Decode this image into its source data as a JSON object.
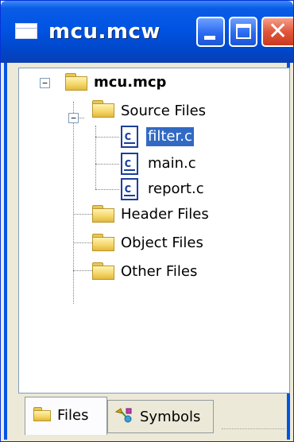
{
  "window": {
    "title": "mcu.mcw",
    "accent": "#0054e3",
    "selection_color": "#316ac5"
  },
  "tree": {
    "root": {
      "label": "mcu.mcp",
      "icon": "folder-icon",
      "expanded": true
    },
    "source_files": {
      "label": "Source Files",
      "icon": "folder-icon",
      "expanded": true
    },
    "files": [
      {
        "label": "filter.c",
        "icon": "c-file-icon",
        "selected": true
      },
      {
        "label": "main.c",
        "icon": "c-file-icon",
        "selected": false
      },
      {
        "label": "report.c",
        "icon": "c-file-icon",
        "selected": false
      }
    ],
    "header_files": {
      "label": "Header Files",
      "icon": "folder-icon"
    },
    "object_files": {
      "label": "Object Files",
      "icon": "folder-icon"
    },
    "other_files": {
      "label": "Other Files",
      "icon": "folder-icon"
    }
  },
  "tabs": [
    {
      "label": "Files",
      "icon": "folder-icon",
      "active": true
    },
    {
      "label": "Symbols",
      "icon": "symbols-icon",
      "active": false
    }
  ],
  "expander": {
    "collapse_glyph": "−"
  }
}
